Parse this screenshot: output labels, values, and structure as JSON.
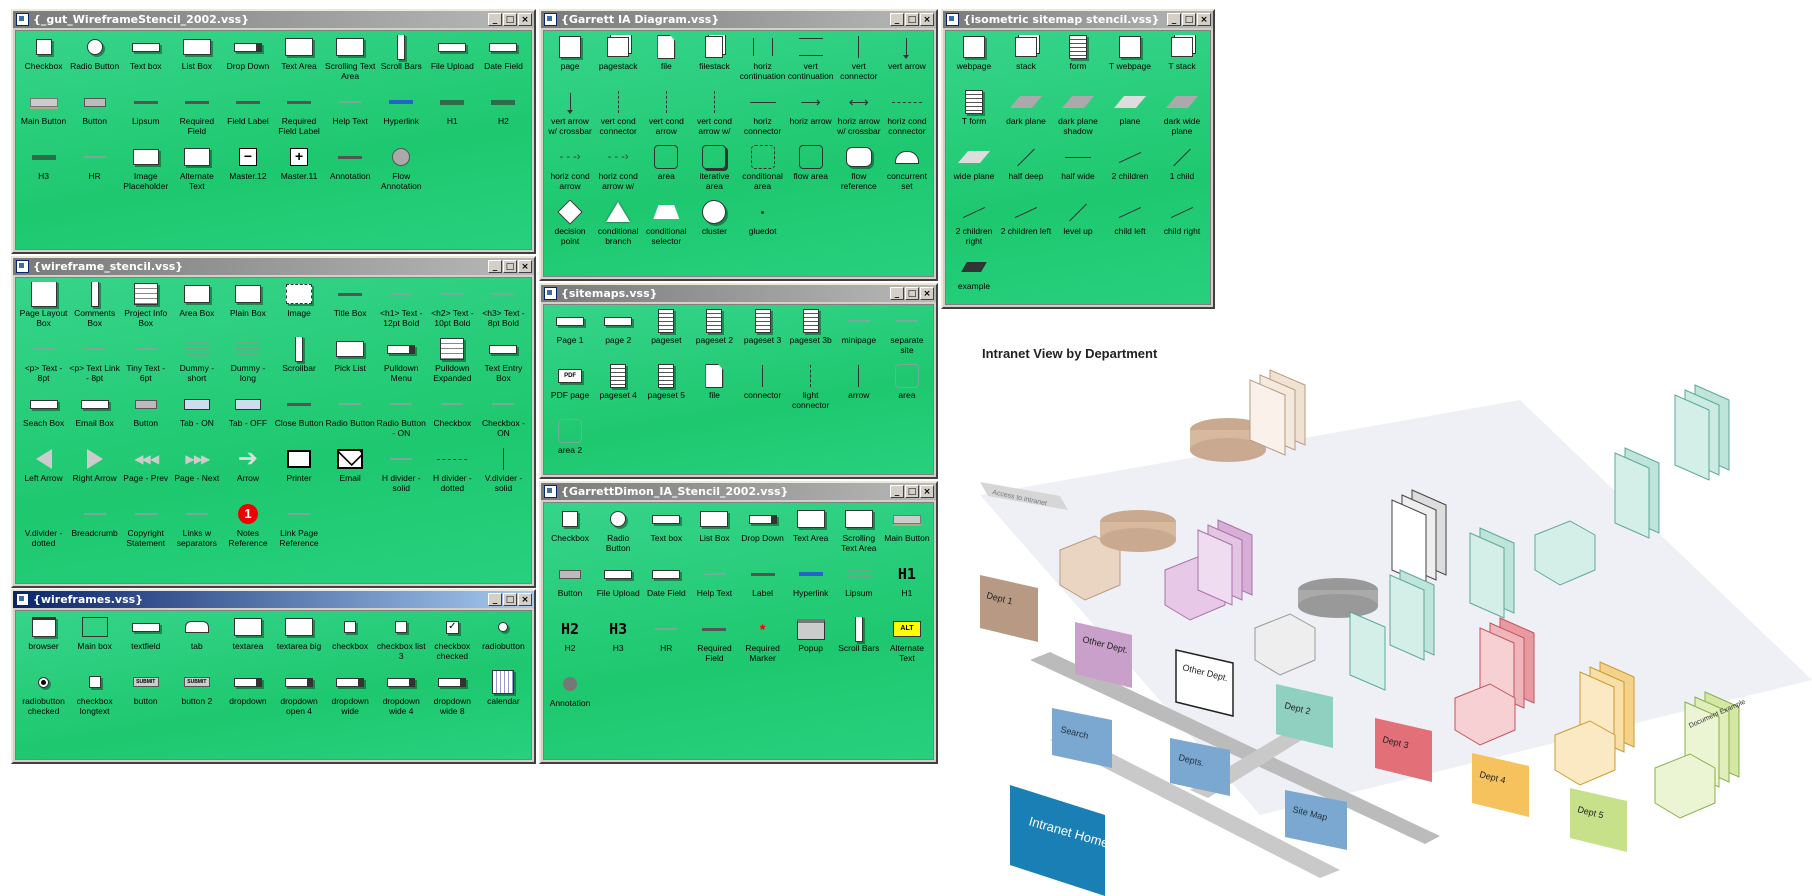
{
  "windows": {
    "gut": {
      "title": "{_gut_WireframeStencil_2002.vss}",
      "cols": 10,
      "items": [
        {
          "label": "Checkbox",
          "icon": "checkbox"
        },
        {
          "label": "Radio Button",
          "icon": "radio"
        },
        {
          "label": "Text box",
          "icon": "textbox"
        },
        {
          "label": "List Box",
          "icon": "listbox"
        },
        {
          "label": "Drop Down",
          "icon": "dropdown"
        },
        {
          "label": "Text Area",
          "icon": "textarea"
        },
        {
          "label": "Scrolling Text Area",
          "icon": "textarea"
        },
        {
          "label": "Scroll Bars",
          "icon": "scrollbar"
        },
        {
          "label": "File Upload",
          "icon": "textbox"
        },
        {
          "label": "Date Field",
          "icon": "textbox"
        },
        {
          "label": "Main Button",
          "icon": "mainbutton"
        },
        {
          "label": "Button",
          "icon": "button"
        },
        {
          "label": "Lipsum",
          "icon": "line"
        },
        {
          "label": "Required Field",
          "icon": "line"
        },
        {
          "label": "Field Label",
          "icon": "line"
        },
        {
          "label": "Required Field Label",
          "icon": "line"
        },
        {
          "label": "Help Text",
          "icon": "line-light"
        },
        {
          "label": "Hyperlink",
          "icon": "hyperlink"
        },
        {
          "label": "H1",
          "icon": "heading"
        },
        {
          "label": "H2",
          "icon": "heading"
        },
        {
          "label": "H3",
          "icon": "heading"
        },
        {
          "label": "HR",
          "icon": "line-light"
        },
        {
          "label": "Image Placeholder",
          "icon": "imageph"
        },
        {
          "label": "Alternate Text",
          "icon": "box"
        },
        {
          "label": "Master.12",
          "icon": "minus-box"
        },
        {
          "label": "Master.11",
          "icon": "plus-box"
        },
        {
          "label": "Annotation",
          "icon": "line"
        },
        {
          "label": "Flow Annotation",
          "icon": "flowann"
        }
      ]
    },
    "garrett": {
      "title": "{Garrett IA Diagram.vss}",
      "cols": 8,
      "items": [
        {
          "label": "page",
          "icon": "page"
        },
        {
          "label": "pagestack",
          "icon": "pagestack"
        },
        {
          "label": "file",
          "icon": "file"
        },
        {
          "label": "filestack",
          "icon": "filestack"
        },
        {
          "label": "horiz continuation",
          "icon": "bracket"
        },
        {
          "label": "vert continuation",
          "icon": "vbracket"
        },
        {
          "label": "vert connector",
          "icon": "vline"
        },
        {
          "label": "vert arrow",
          "icon": "varrow"
        },
        {
          "label": "vert arrow w/ crossbar",
          "icon": "varrow"
        },
        {
          "label": "vert cond connector",
          "icon": "vdash"
        },
        {
          "label": "vert cond arrow",
          "icon": "vdash"
        },
        {
          "label": "vert cond arrow w/",
          "icon": "vdash"
        },
        {
          "label": "horiz connector",
          "icon": "hline"
        },
        {
          "label": "horiz arrow",
          "icon": "harrow"
        },
        {
          "label": "horiz arrow w/ crossbar",
          "icon": "harrow2"
        },
        {
          "label": "horiz cond connector",
          "icon": "hdash"
        },
        {
          "label": "horiz cond arrow",
          "icon": "hdasharrow"
        },
        {
          "label": "horiz cond arrow w/",
          "icon": "hdasharrow"
        },
        {
          "label": "area",
          "icon": "area"
        },
        {
          "label": "iterative area",
          "icon": "iterarea"
        },
        {
          "label": "conditional area",
          "icon": "condarea"
        },
        {
          "label": "flow area",
          "icon": "area"
        },
        {
          "label": "flow reference",
          "icon": "flowref"
        },
        {
          "label": "concurrent set",
          "icon": "concset"
        },
        {
          "label": "decision point",
          "icon": "diamond"
        },
        {
          "label": "conditional branch",
          "icon": "triangle"
        },
        {
          "label": "conditional selector",
          "icon": "trapezoid"
        },
        {
          "label": "cluster",
          "icon": "circle"
        },
        {
          "label": "gluedot",
          "icon": "dot"
        }
      ]
    },
    "iso": {
      "title": "{isometric sitemap stencil.vss}",
      "cols": 5,
      "items": [
        {
          "label": "webpage",
          "icon": "page"
        },
        {
          "label": "stack",
          "icon": "pagestack"
        },
        {
          "label": "form",
          "icon": "form"
        },
        {
          "label": "T webpage",
          "icon": "page"
        },
        {
          "label": "T stack",
          "icon": "pagestack"
        },
        {
          "label": "T form",
          "icon": "form"
        },
        {
          "label": "dark plane",
          "icon": "plane-dark"
        },
        {
          "label": "dark plane shadow",
          "icon": "plane-dark"
        },
        {
          "label": "plane",
          "icon": "plane"
        },
        {
          "label": "dark wide plane",
          "icon": "plane-dark"
        },
        {
          "label": "wide plane",
          "icon": "plane"
        },
        {
          "label": "half deep",
          "icon": "diag"
        },
        {
          "label": "half wide",
          "icon": "hline"
        },
        {
          "label": "2 children",
          "icon": "children"
        },
        {
          "label": "1 child",
          "icon": "diag"
        },
        {
          "label": "2 children right",
          "icon": "children"
        },
        {
          "label": "2 children left",
          "icon": "children"
        },
        {
          "label": "level up",
          "icon": "diag"
        },
        {
          "label": "child left",
          "icon": "children"
        },
        {
          "label": "child right",
          "icon": "children"
        },
        {
          "label": "example",
          "icon": "example"
        }
      ]
    },
    "wireframe": {
      "title": "{wireframe_stencil.vss}",
      "cols": 10,
      "items": [
        {
          "label": "Page Layout Box",
          "icon": "page-layout"
        },
        {
          "label": "Comments Box",
          "icon": "scrollbar"
        },
        {
          "label": "Project Info Box",
          "icon": "projinfo"
        },
        {
          "label": "Area Box",
          "icon": "box"
        },
        {
          "label": "Plain Box",
          "icon": "box"
        },
        {
          "label": "Image",
          "icon": "imagebox"
        },
        {
          "label": "Title Box",
          "icon": "line"
        },
        {
          "label": "<h1> Text - 12pt Bold",
          "icon": "line-light"
        },
        {
          "label": "<h2> Text - 10pt Bold",
          "icon": "line-light"
        },
        {
          "label": "<h3> Text - 8pt Bold",
          "icon": "line-light"
        },
        {
          "label": "<p> Text - 8pt",
          "icon": "line-light"
        },
        {
          "label": "<p> Text Link - 8pt",
          "icon": "line-light"
        },
        {
          "label": "Tiny Text - 6pt",
          "icon": "line-light"
        },
        {
          "label": "Dummy - short",
          "icon": "dummy"
        },
        {
          "label": "Dummy - long",
          "icon": "dummy"
        },
        {
          "label": "Scrollbar",
          "icon": "scrollbar"
        },
        {
          "label": "Pick List",
          "icon": "listbox"
        },
        {
          "label": "Pulldown Menu",
          "icon": "dropdown"
        },
        {
          "label": "Pulldown Expanded",
          "icon": "projinfo"
        },
        {
          "label": "Text Entry Box",
          "icon": "textbox"
        },
        {
          "label": "Seach Box",
          "icon": "textbox"
        },
        {
          "label": "Email Box",
          "icon": "textbox"
        },
        {
          "label": "Button",
          "icon": "button"
        },
        {
          "label": "Tab - ON",
          "icon": "tab"
        },
        {
          "label": "Tab - OFF",
          "icon": "tab"
        },
        {
          "label": "Close Button",
          "icon": "line"
        },
        {
          "label": "Radio Button",
          "icon": "line-light"
        },
        {
          "label": "Radio Button - ON",
          "icon": "line-light"
        },
        {
          "label": "Checkbox",
          "icon": "line-light"
        },
        {
          "label": "Checkbox - ON",
          "icon": "line-light"
        },
        {
          "label": "Left Arrow",
          "icon": "leftarrow"
        },
        {
          "label": "Right Arrow",
          "icon": "rightarrow"
        },
        {
          "label": "Page - Prev",
          "icon": "prev"
        },
        {
          "label": "Page - Next",
          "icon": "next"
        },
        {
          "label": "Arrow",
          "icon": "bigarrow"
        },
        {
          "label": "Printer",
          "icon": "printer"
        },
        {
          "label": "Email",
          "icon": "envelope"
        },
        {
          "label": "H divider - solid",
          "icon": "line-light"
        },
        {
          "label": "H divider - dotted",
          "icon": "hdash"
        },
        {
          "label": "V.divider - solid",
          "icon": "vline"
        },
        {
          "label": "V.divider - dotted",
          "icon": "blank"
        },
        {
          "label": "Breadcrumb",
          "icon": "line-light"
        },
        {
          "label": "Copyright Statement",
          "icon": "line-light"
        },
        {
          "label": "Links w separators",
          "icon": "line-light"
        },
        {
          "label": "Notes Reference",
          "icon": "notes"
        },
        {
          "label": "Link Page Reference",
          "icon": "line-light"
        }
      ]
    },
    "sitemaps": {
      "title": "{sitemaps.vss}",
      "cols": 8,
      "items": [
        {
          "label": "Page 1",
          "icon": "textbox"
        },
        {
          "label": "page 2",
          "icon": "textbox"
        },
        {
          "label": "pageset",
          "icon": "pageset"
        },
        {
          "label": "pageset 2",
          "icon": "pageset"
        },
        {
          "label": "pageset 3",
          "icon": "pageset"
        },
        {
          "label": "pageset 3b",
          "icon": "pageset"
        },
        {
          "label": "minipage",
          "icon": "line-light"
        },
        {
          "label": "separate site",
          "icon": "line-light"
        },
        {
          "label": "PDF page",
          "icon": "pdf"
        },
        {
          "label": "pageset 4",
          "icon": "pageset"
        },
        {
          "label": "pageset 5",
          "icon": "pageset"
        },
        {
          "label": "file",
          "icon": "file"
        },
        {
          "label": "connector",
          "icon": "vline"
        },
        {
          "label": "light connector",
          "icon": "vdash"
        },
        {
          "label": "arrow",
          "icon": "vline"
        },
        {
          "label": "area",
          "icon": "area-light"
        },
        {
          "label": "area 2",
          "icon": "area-light"
        }
      ]
    },
    "dimon": {
      "title": "{GarrettDimon_IA_Stencil_2002.vss}",
      "cols": 8,
      "items": [
        {
          "label": "Checkbox",
          "icon": "checkbox"
        },
        {
          "label": "Radio Button",
          "icon": "radio"
        },
        {
          "label": "Text box",
          "icon": "textbox"
        },
        {
          "label": "List Box",
          "icon": "listbox"
        },
        {
          "label": "Drop Down",
          "icon": "dropdown"
        },
        {
          "label": "Text Area",
          "icon": "textarea"
        },
        {
          "label": "Scrolling Text Area",
          "icon": "textarea"
        },
        {
          "label": "Main Button",
          "icon": "mainbutton"
        },
        {
          "label": "Button",
          "icon": "button"
        },
        {
          "label": "File Upload",
          "icon": "textbox"
        },
        {
          "label": "Date Field",
          "icon": "textbox"
        },
        {
          "label": "Help Text",
          "icon": "line-light"
        },
        {
          "label": "Label",
          "icon": "line"
        },
        {
          "label": "Hyperlink",
          "icon": "hyperlink"
        },
        {
          "label": "Lipsum",
          "icon": "dummy"
        },
        {
          "label": "H1",
          "icon": "h1"
        },
        {
          "label": "H2",
          "icon": "h2"
        },
        {
          "label": "H3",
          "icon": "h3"
        },
        {
          "label": "HR",
          "icon": "line-light"
        },
        {
          "label": "Required Field",
          "icon": "line"
        },
        {
          "label": "Required Marker",
          "icon": "star"
        },
        {
          "label": "Popup",
          "icon": "popup"
        },
        {
          "label": "Scroll Bars",
          "icon": "scrollbar"
        },
        {
          "label": "Alternate Text",
          "icon": "alt"
        },
        {
          "label": "Annotation",
          "icon": "annotation"
        }
      ]
    },
    "wireframes": {
      "title": "{wireframes.vss}",
      "cols": 10,
      "items": [
        {
          "label": "browser",
          "icon": "browser"
        },
        {
          "label": "Main box",
          "icon": "mainbox"
        },
        {
          "label": "textfield",
          "icon": "textfield"
        },
        {
          "label": "tab",
          "icon": "tabshape"
        },
        {
          "label": "textarea",
          "icon": "textarea"
        },
        {
          "label": "textarea big",
          "icon": "textarea"
        },
        {
          "label": "checkbox",
          "icon": "checkbox-small"
        },
        {
          "label": "checkbox list 3",
          "icon": "checkbox-small"
        },
        {
          "label": "checkbox checked",
          "icon": "checkbox-checked"
        },
        {
          "label": "radiobutton",
          "icon": "radio-small"
        },
        {
          "label": "radiobutton checked",
          "icon": "radio-checked"
        },
        {
          "label": "checkbox longtext",
          "icon": "checkbox-small"
        },
        {
          "label": "button",
          "icon": "submit"
        },
        {
          "label": "button 2",
          "icon": "submit"
        },
        {
          "label": "dropdown",
          "icon": "dropdown"
        },
        {
          "label": "dropdown open 4",
          "icon": "dropdown"
        },
        {
          "label": "dropdown wide",
          "icon": "dropdown"
        },
        {
          "label": "dropdown wide 4",
          "icon": "dropdown"
        },
        {
          "label": "dropdown wide 8",
          "icon": "dropdown"
        },
        {
          "label": "calendar",
          "icon": "calendar"
        }
      ]
    }
  },
  "title_buttons": {
    "minimize": "_",
    "maximize": "□",
    "close": "×"
  },
  "icon_text": {
    "submit": "SUBMIT",
    "alt": "ALT",
    "h1": "H1",
    "h2": "H2",
    "h3": "H3",
    "notes": "1",
    "pdf": "PDF"
  },
  "diagram": {
    "title": "Intranet View by Department",
    "labels": {
      "intranet_home": "Intranet Home Page",
      "search": "Search",
      "depts": "Depts.",
      "site_map": "Site Map",
      "dept1": "Dept 1",
      "other_dept": "Other Dept.",
      "other_dept_2": "Other Dept.",
      "dept2": "Dept 2",
      "dept3": "Dept 3",
      "dept4": "Dept 4",
      "dept5": "Dept 5",
      "doc_example": "Document Example",
      "access_label": "Access to intranet"
    },
    "colors": {
      "home": "#1a7fb5",
      "dept1": "#b89a84",
      "other": "#c9a0c9",
      "dept2": "#8fd0c0",
      "dept3": "#e36f78",
      "dept4": "#f5c25d",
      "dept5": "#c7e08a",
      "nav": "#7aa8d0"
    }
  }
}
